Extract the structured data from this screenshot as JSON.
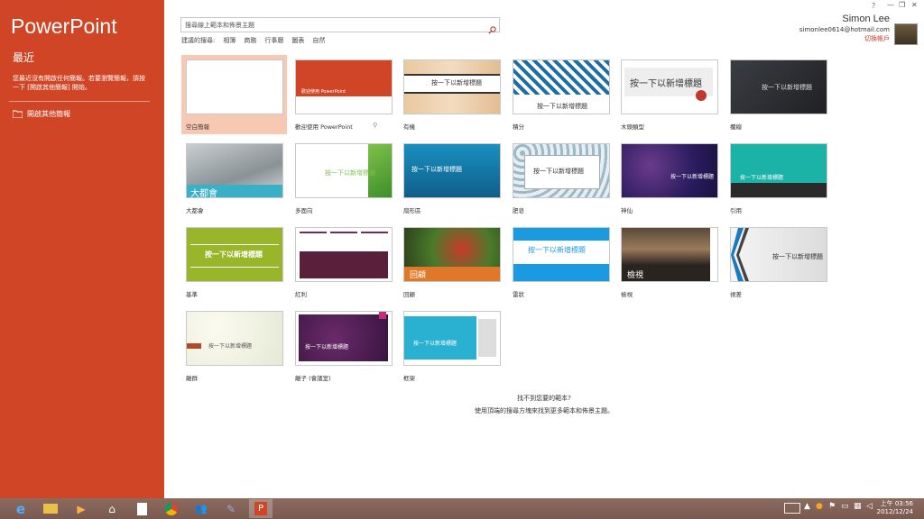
{
  "sidebar": {
    "app_title": "PowerPoint",
    "recent_title": "最近",
    "no_recent_text": "您最近沒有開啟任何簡報。若要瀏覽簡報，請按一下 [開啟其他簡報] 開始。",
    "open_other_label": "開啟其他簡報"
  },
  "search": {
    "placeholder": "搜尋線上範本和佈景主題",
    "suggested_label": "建議的搜尋:",
    "suggestions": [
      "相簿",
      "商務",
      "行事曆",
      "圖表",
      "自然"
    ]
  },
  "templates": [
    {
      "label": "空白簡報"
    },
    {
      "label": "歡迎使用 PowerPoint",
      "title_text": "歡迎使用 PowerPoint"
    },
    {
      "label": "有機",
      "title_text": "按一下以新增標題"
    },
    {
      "label": "積分",
      "title_text": "按一下以新增標題"
    },
    {
      "label": "木頭類型",
      "title_text": "按一下以新增標題"
    },
    {
      "label": "擱線",
      "title_text": "按一下以新增標題"
    },
    {
      "label": "大都會",
      "title_text": "大都會"
    },
    {
      "label": "多面向",
      "title_text": "按一下以新增標題"
    },
    {
      "label": "扇形區",
      "title_text": "按一下以新增標題"
    },
    {
      "label": "肥皂",
      "title_text": "按一下以新增標題"
    },
    {
      "label": "神仙",
      "title_text": "按一下以新增標題"
    },
    {
      "label": "引用",
      "title_text": "按一下以新增標題"
    },
    {
      "label": "基準",
      "title_text": "按一下以新增標題"
    },
    {
      "label": "紅利"
    },
    {
      "label": "回顧",
      "title_text": "回顧"
    },
    {
      "label": "雷狀",
      "title_text": "按一下以新增標題"
    },
    {
      "label": "檢視",
      "title_text": "檢視"
    },
    {
      "label": "視差",
      "title_text": "按一下以新增標題"
    },
    {
      "label": "離群",
      "title_text": "按一下以新增標題"
    },
    {
      "label": "離子 (會議室)",
      "title_text": "按一下以新增標題"
    },
    {
      "label": "框架",
      "title_text": "按一下以新增標題"
    }
  ],
  "footer": {
    "question": "找不到您要的範本?",
    "hint": "使用頂端的搜尋方塊來找到更多範本和佈景主題。"
  },
  "account": {
    "name": "Simon Lee",
    "email": "simonlee0614@hotmail.com",
    "switch_label": "切換帳戶",
    "help": "?"
  },
  "taskbar": {
    "time": "上午 03:56",
    "date": "2012/12/24"
  }
}
